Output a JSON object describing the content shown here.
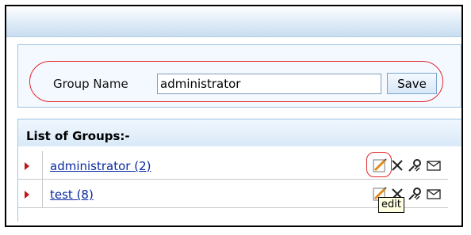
{
  "form": {
    "label": "Group Name",
    "value": "administrator",
    "save_label": "Save"
  },
  "groups": {
    "title": "List of Groups:-",
    "items": [
      {
        "label": "administrator  (2)"
      },
      {
        "label": "test  (8)"
      }
    ]
  },
  "tooltip": "edit",
  "colors": {
    "highlight": "#e0282d",
    "link": "#0a2aa0",
    "header_gradient_end": "#c8ddf0"
  },
  "icons": [
    "edit-icon",
    "delete-icon",
    "permissions-icon",
    "mail-icon"
  ]
}
